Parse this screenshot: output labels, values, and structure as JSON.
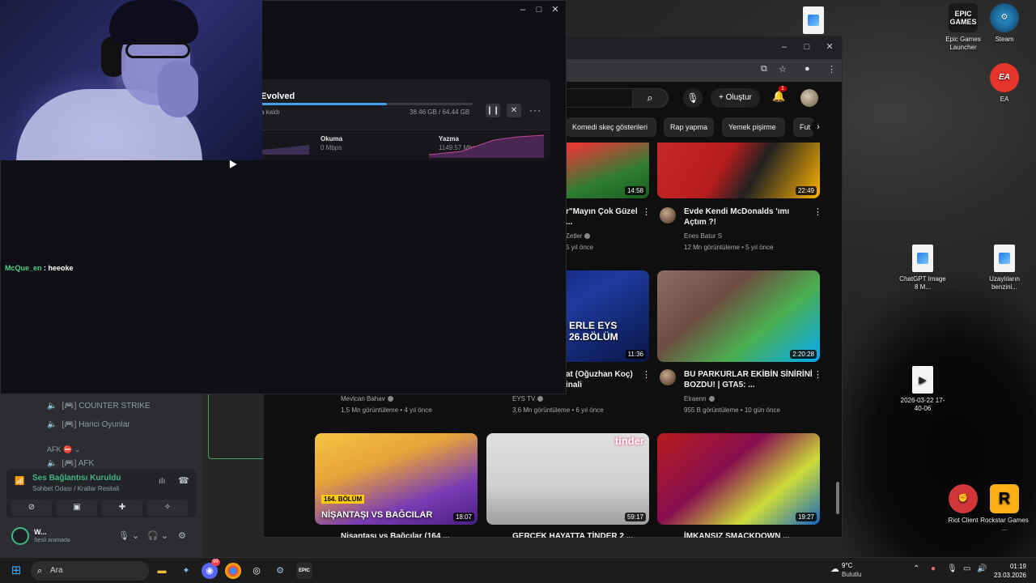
{
  "desktop_icons": [
    {
      "label": "Epic Games Launcher",
      "glyph": "EPIC GAMES",
      "icon": "epic-games-icon"
    },
    {
      "label": "Steam",
      "icon": "steam-icon"
    },
    {
      "label": "EA",
      "glyph": "EA",
      "icon": "ea-icon"
    },
    {
      "label": "ChatGPT Image 8 M...",
      "icon": "image-file-icon"
    },
    {
      "label": "Uzaylıların benzini...",
      "icon": "image-file-icon"
    },
    {
      "label": "2026-03-22 17-40-06",
      "icon": "video-file-icon"
    },
    {
      "label": "Riot Client",
      "icon": "riot-client-icon"
    },
    {
      "label": "Rockstar Games ...",
      "glyph": "R",
      "icon": "rockstar-icon"
    }
  ],
  "download": {
    "title": "Evolved",
    "remaining": "a kaldı",
    "size": "38.46 GB / 64.44 GB",
    "progress": 0.597,
    "read_label": "Okuma",
    "read_value": "0 Mbps",
    "write_label": "Yazma",
    "write_value": "1149.57 Mbps"
  },
  "chat": {
    "user": "McQue_en",
    "message": " : heeoke"
  },
  "youtube": {
    "create_label": "Oluştur",
    "notification_count": "1",
    "chips": [
      "Komedi skeç gösterileri",
      "Rap yapma",
      "Yemek pişirme",
      "Fut"
    ],
    "videos": [
      {
        "title": "r\"Mayın Çok Güzel ...",
        "channel": "Zetler",
        "meta": "",
        "ago": "5 yıl önce",
        "duration": "14:58"
      },
      {
        "title": "Evde Kendi McDonalds 'ımı Açtım ?!",
        "channel": "Enes Batur S",
        "meta": "12 Mn görüntüleme • 5 yıl önce",
        "duration": "22:49"
      },
      {
        "title": "at (Oğuzhan Koç) inali",
        "channel": "Mevlcan Bahav",
        "meta": "1,5 Mn görüntüleme • 4 yıl önce",
        "duration": "11:36",
        "caption": "ERLE EYS 26.BÖLÜM"
      },
      {
        "title": "BU PARKURLAR EKİBİN SİNİRİNİ BOZDU! | GTA5: ...",
        "channel": "Elraenn",
        "meta": "955 B görüntüleme • 10 gün önce",
        "duration": "2:20:28"
      },
      {
        "title": "Nişantaşı vs Bağcılar (164 ...",
        "channel": "EYS TV",
        "meta": "3,6 Mn görüntüleme • 6 yıl önce",
        "duration": "18:07",
        "caption": "NİŞANTAŞI VS BAĞCILAR",
        "badge": "164. BÖLÜM"
      },
      {
        "title": "GERÇEK HAYATTA TİNDER 2 ...",
        "duration": "59:17",
        "badge": "tinder"
      },
      {
        "title": "İMKANSIZ SMACKDOWN ...",
        "duration": "19:27"
      }
    ]
  },
  "discord": {
    "channels": [
      "COUNTER STRIKE",
      "Harici Oyunlar"
    ],
    "category": "AFK",
    "afk_channel": "AFK",
    "voice_status": "Ses Bağlantısı Kuruldu",
    "voice_room": "Sohbet Odası / Krallar Resitali",
    "user_name": "W...",
    "user_status": "Sesli aramada"
  },
  "taskbar": {
    "search_placeholder": "Ara",
    "temp": "9°C",
    "weather": "Bulutlu",
    "time": "01:19",
    "date": "23.03.2026",
    "discord_badge": "99"
  }
}
